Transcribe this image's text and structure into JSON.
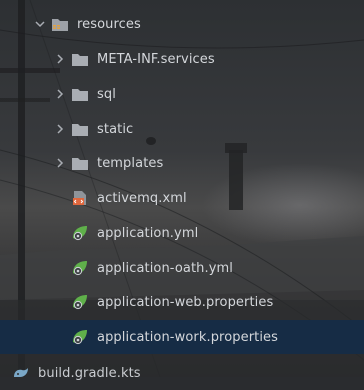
{
  "tree": {
    "root": {
      "label": "resources",
      "icon": "resources-folder-icon",
      "expanded": true
    },
    "folders": [
      {
        "label": "META-INF.services",
        "icon": "folder-icon"
      },
      {
        "label": "sql",
        "icon": "folder-icon"
      },
      {
        "label": "static",
        "icon": "folder-icon"
      },
      {
        "label": "templates",
        "icon": "folder-icon"
      }
    ],
    "files": [
      {
        "label": "activemq.xml",
        "icon": "xml-file-icon"
      },
      {
        "label": "application.yml",
        "icon": "spring-config-icon"
      },
      {
        "label": "application-oath.yml",
        "icon": "spring-config-icon"
      },
      {
        "label": "application-web.properties",
        "icon": "spring-config-icon"
      },
      {
        "label": "application-work.properties",
        "icon": "spring-config-icon",
        "selected": true
      }
    ],
    "bottom": {
      "label": "build.gradle.kts",
      "icon": "gradle-icon"
    }
  },
  "colors": {
    "selection": "#152d48",
    "folder": "#a9adb3",
    "spring": "#5fb04a",
    "xml": "#e0673d",
    "text": "#d4d7db"
  }
}
